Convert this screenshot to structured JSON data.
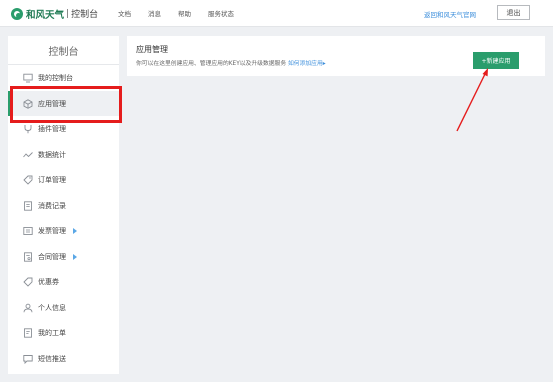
{
  "header": {
    "brand_name": "和风天气",
    "brand_separator": "|",
    "brand_sub": "控制台",
    "nav": [
      "文档",
      "消息",
      "帮助",
      "服务状态"
    ],
    "official_site_link": "返回和风天气官网",
    "logout_label": "退出"
  },
  "sidebar": {
    "title": "控制台",
    "items": [
      {
        "label": "我的控制台",
        "icon": "monitor-icon"
      },
      {
        "label": "应用管理",
        "icon": "cube-icon",
        "active": true
      },
      {
        "label": "插件管理",
        "icon": "plugin-icon"
      },
      {
        "label": "数据统计",
        "icon": "chart-line-icon"
      },
      {
        "label": "订单管理",
        "icon": "tag-icon"
      },
      {
        "label": "消费记录",
        "icon": "receipt-icon"
      },
      {
        "label": "发票管理",
        "icon": "invoice-icon",
        "expandable": true
      },
      {
        "label": "合同管理",
        "icon": "contract-icon",
        "expandable": true
      },
      {
        "label": "优惠券",
        "icon": "coupon-icon"
      },
      {
        "label": "个人信息",
        "icon": "user-icon"
      },
      {
        "label": "我的工单",
        "icon": "ticket-icon"
      },
      {
        "label": "短信推送",
        "icon": "message-icon"
      }
    ]
  },
  "main": {
    "title": "应用管理",
    "description": "你可以在这里创建应用、管理应用的KEY以及升级数据服务",
    "help_link": "如何添加应用",
    "help_link_arrow": "▸",
    "new_app_label": "+新建应用"
  },
  "colors": {
    "brand_green": "#2a9d6c",
    "link_blue": "#3a8ddb",
    "annotation_red": "#e51c1c",
    "page_bg": "#eef0f3"
  }
}
